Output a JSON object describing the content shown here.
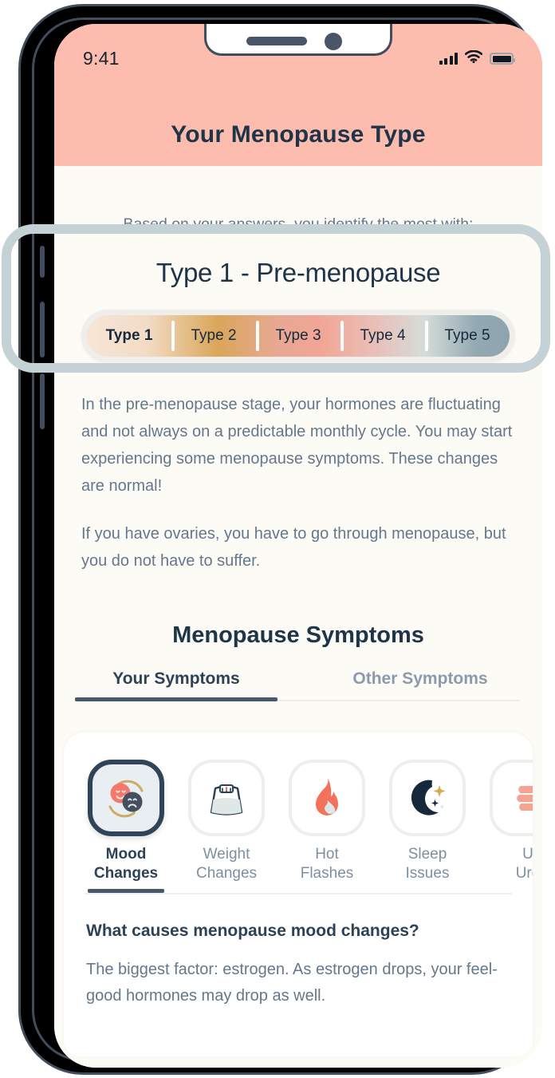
{
  "statusbar": {
    "time": "9:41",
    "signal_icon": "signal-bars-icon",
    "wifi_icon": "wifi-icon",
    "battery_icon": "battery-icon"
  },
  "header": {
    "title": "Your Menopause Type",
    "background": "#fcbcae"
  },
  "intro": {
    "subtitle": "Based on your answers, you identify the most with:",
    "type_title": "Type 1 - Pre-menopause"
  },
  "type_selector": {
    "selected": "Type 1",
    "options": [
      "Type 1",
      "Type 2",
      "Type 3",
      "Type 4",
      "Type 5"
    ]
  },
  "description": {
    "paragraph_1": "In the pre-menopause stage, your hormones are fluctuating and not always on a predictable monthly cycle. You may start experiencing some menopause symptoms. These changes are normal!",
    "paragraph_2": "If you have ovaries, you have to go through menopause, but you do not have to suffer."
  },
  "symptoms_section": {
    "title": "Menopause Symptoms",
    "tabs": [
      {
        "label": "Your Symptoms",
        "active": true
      },
      {
        "label": "Other Symptoms",
        "active": false
      }
    ],
    "items": [
      {
        "line1": "Mood",
        "line2": "Changes",
        "icon": "mood-changes-icon",
        "active": true
      },
      {
        "line1": "Weight",
        "line2": "Changes",
        "icon": "weight-scale-icon",
        "active": false
      },
      {
        "line1": "Hot",
        "line2": "Flashes",
        "icon": "flame-icon",
        "active": false
      },
      {
        "line1": "Sleep",
        "line2": "Issues",
        "icon": "moon-stars-icon",
        "active": false
      },
      {
        "line1": "U",
        "line2": "Urg",
        "icon": "urinary-urgency-icon",
        "active": false
      }
    ],
    "detail": {
      "question": "What causes menopause mood changes?",
      "answer": "The biggest factor: estrogen. As estrogen drops, your feel-good hormones may drop as well."
    }
  },
  "colors": {
    "header_pink": "#fcbcae",
    "screen_bg": "#fdfbf6",
    "ink": "#1e3448",
    "muted": "#64788c",
    "accent_dark": "#45596e",
    "highlight_ring": "#c4d2d6",
    "coral": "#f4796a"
  }
}
